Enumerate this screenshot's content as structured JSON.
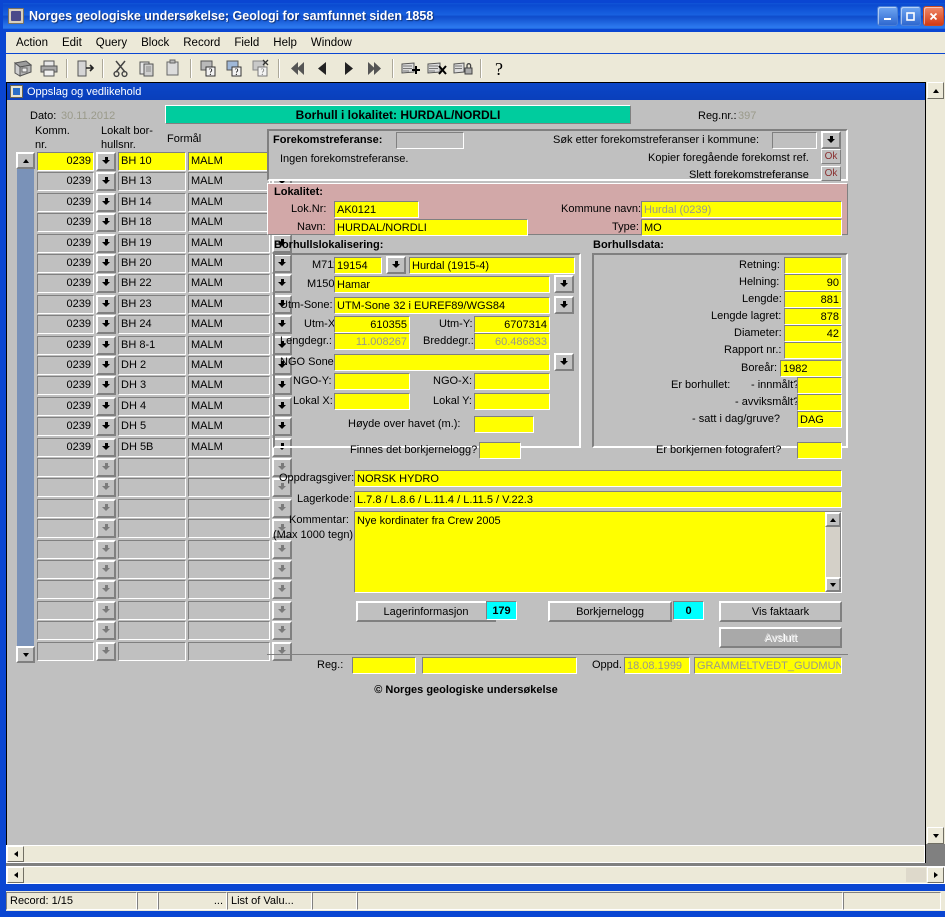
{
  "window": {
    "title": "Norges geologiske undersøkelse;  Geologi for samfunnet siden 1858",
    "minimize": "_",
    "maximize": "□",
    "close": "✕"
  },
  "menu": [
    {
      "label": "Action"
    },
    {
      "label": "Edit"
    },
    {
      "label": "Query"
    },
    {
      "label": "Block"
    },
    {
      "label": "Record"
    },
    {
      "label": "Field"
    },
    {
      "label": "Help"
    },
    {
      "label": "Window"
    }
  ],
  "toolbar": [
    {
      "name": "save-icon"
    },
    {
      "name": "print-icon"
    },
    {
      "sep": true
    },
    {
      "name": "exit-icon"
    },
    {
      "sep": true
    },
    {
      "name": "cut-icon"
    },
    {
      "name": "copy-icon"
    },
    {
      "name": "paste-icon"
    },
    {
      "sep": true
    },
    {
      "name": "enter-query-icon"
    },
    {
      "name": "execute-query-icon"
    },
    {
      "name": "cancel-query-icon"
    },
    {
      "sep": true
    },
    {
      "name": "first-record-icon"
    },
    {
      "name": "previous-record-icon"
    },
    {
      "name": "next-record-icon"
    },
    {
      "name": "last-record-icon"
    },
    {
      "sep": true
    },
    {
      "name": "insert-record-icon"
    },
    {
      "name": "delete-record-icon"
    },
    {
      "name": "lock-record-icon"
    },
    {
      "sep": true
    },
    {
      "name": "help-icon"
    }
  ],
  "mdi": {
    "title": "Oppslag og vedlikehold"
  },
  "header": {
    "date_label": "Dato:",
    "date_value": "30.11.2012",
    "banner": "Borhull i lokalitet: HURDAL/NORDLI",
    "regnr_label": "Reg.nr.:",
    "regnr_value": "397"
  },
  "grid": {
    "columns": [
      "Komm.\nnr.",
      "Lokalt bor-\nhullsnr.",
      "Formål"
    ],
    "col1_header_l1": "Komm.",
    "col1_header_l2": "nr.",
    "col2_header_l1": "Lokalt bor-",
    "col2_header_l2": "hullsnr.",
    "col3_header": "Formål",
    "rows": [
      {
        "komm": "0239",
        "borhull": "BH 10",
        "formal": "MALM",
        "current": true
      },
      {
        "komm": "0239",
        "borhull": "BH 13",
        "formal": "MALM",
        "current": false
      },
      {
        "komm": "0239",
        "borhull": "BH 14",
        "formal": "MALM",
        "current": false
      },
      {
        "komm": "0239",
        "borhull": "BH 18",
        "formal": "MALM",
        "current": false
      },
      {
        "komm": "0239",
        "borhull": "BH 19",
        "formal": "MALM",
        "current": false
      },
      {
        "komm": "0239",
        "borhull": "BH 20",
        "formal": "MALM",
        "current": false
      },
      {
        "komm": "0239",
        "borhull": "BH 22",
        "formal": "MALM",
        "current": false
      },
      {
        "komm": "0239",
        "borhull": "BH 23",
        "formal": "MALM",
        "current": false
      },
      {
        "komm": "0239",
        "borhull": "BH 24",
        "formal": "MALM",
        "current": false
      },
      {
        "komm": "0239",
        "borhull": "BH 8-1",
        "formal": "MALM",
        "current": false
      },
      {
        "komm": "0239",
        "borhull": "DH 2",
        "formal": "MALM",
        "current": false
      },
      {
        "komm": "0239",
        "borhull": "DH 3",
        "formal": "MALM",
        "current": false
      },
      {
        "komm": "0239",
        "borhull": "DH 4",
        "formal": "MALM",
        "current": false
      },
      {
        "komm": "0239",
        "borhull": "DH 5",
        "formal": "MALM",
        "current": false
      },
      {
        "komm": "0239",
        "borhull": "DH 5B",
        "formal": "MALM",
        "current": false
      },
      {
        "komm": "",
        "borhull": "",
        "formal": "",
        "current": false
      },
      {
        "komm": "",
        "borhull": "",
        "formal": "",
        "current": false
      },
      {
        "komm": "",
        "borhull": "",
        "formal": "",
        "current": false
      },
      {
        "komm": "",
        "borhull": "",
        "formal": "",
        "current": false
      },
      {
        "komm": "",
        "borhull": "",
        "formal": "",
        "current": false
      },
      {
        "komm": "",
        "borhull": "",
        "formal": "",
        "current": false
      },
      {
        "komm": "",
        "borhull": "",
        "formal": "",
        "current": false
      },
      {
        "komm": "",
        "borhull": "",
        "formal": "",
        "current": false
      },
      {
        "komm": "",
        "borhull": "",
        "formal": "",
        "current": false
      },
      {
        "komm": "",
        "borhull": "",
        "formal": "",
        "current": false
      },
      {
        "komm": "",
        "borhull": "",
        "formal": "",
        "current": false
      },
      {
        "komm": "",
        "borhull": "",
        "formal": "",
        "current": false
      },
      {
        "komm": "",
        "borhull": "",
        "formal": "",
        "current": false
      }
    ]
  },
  "forekomst": {
    "label": "Forekomstreferanse:",
    "value": "",
    "none_text": "Ingen forekomstreferanse.",
    "search_label": "Søk etter forekomstreferanser i kommune:",
    "search_value": "",
    "copy_label": "Kopier foregående forekomst ref.",
    "copy_ok": "Ok",
    "delete_label": "Slett forekomstreferanse",
    "delete_ok": "Ok"
  },
  "lokalitet": {
    "title": "Lokalitet:",
    "loknr_label": "Lok.Nr:",
    "loknr_value": "AK0121",
    "navn_label": "Navn:",
    "navn_value": "HURDAL/NORDLI",
    "kommune_label": "Kommune navn:",
    "kommune_value": "Hurdal (0239)",
    "type_label": "Type:",
    "type_value": "MO"
  },
  "lokalisering": {
    "title": "Borhullslokalisering:",
    "m711_label": "M711:",
    "m711_value": "19154",
    "m711_name": "Hurdal (1915-4)",
    "m1501_label": "M1501:",
    "m1501_value": "Hamar",
    "utmsone_label": "Utm-Sone:",
    "utmsone_value": "UTM-Sone 32 i  EUREF89/WGS84",
    "utmx_label": "Utm-X:",
    "utmx_value": "610355",
    "utmy_label": "Utm-Y:",
    "utmy_value": "6707314",
    "lengdegr_label": "Lengdegr.:",
    "lengdegr_value": "11.008267",
    "breddegr_label": "Breddegr.:",
    "breddegr_value": "60.486833",
    "ngosone_label": "NGO Sone:",
    "ngosone_value": "",
    "ngoy_label": "NGO-Y:",
    "ngoy_value": "",
    "ngox_label": "NGO-X:",
    "ngox_value": "",
    "lokalx_label": "Lokal X:",
    "lokalx_value": "",
    "lokaly_label": "Lokal Y:",
    "lokaly_value": "",
    "hoyde_label": "Høyde over havet (m.):",
    "hoyde_value": ""
  },
  "borhullsdata": {
    "title": "Borhullsdata:",
    "retning_label": "Retning:",
    "retning_value": "",
    "helning_label": "Helning:",
    "helning_value": "90",
    "lengde_label": "Lengde:",
    "lengde_value": "881",
    "lengdelagret_label": "Lengde lagret:",
    "lengdelagret_value": "878",
    "diameter_label": "Diameter:",
    "diameter_value": "42",
    "rapport_label": "Rapport nr.:",
    "rapport_value": "",
    "borear_label": "Boreår:",
    "borear_value": "1982",
    "erborhullet_label": "Er borhullet:",
    "innmalt_label": "- innmålt?",
    "innmalt_value": "",
    "avviksmalt_label": "- avviksmålt?",
    "avviksmalt_value": "",
    "dag_label": "- satt i dag/gruve?",
    "dag_value": "DAG"
  },
  "bottom": {
    "borkjernelogg_label": "Finnes det borkjernelogg?",
    "borkjernelogg_value": "",
    "fotografert_label": "Er borkjernen fotografert?",
    "fotografert_value": "",
    "oppdragsgiver_label": "Oppdragsgiver:",
    "oppdragsgiver_value": "NORSK HYDRO",
    "lagerkode_label": "Lagerkode:",
    "lagerkode_value": "L.7.8 /  L.8.6 / L.11.4 / L.11.5 / V.22.3",
    "kommentar_label": "Kommentar:",
    "kommentar_sub": "(Max 1000 tegn)",
    "kommentar_value": "Nye kordinater fra Crew 2005"
  },
  "buttons": {
    "lagerinformasjon": "Lagerinformasjon",
    "lagerinformasjon_count": "179",
    "borkjernelogg": "Borkjernelogg",
    "borkjernelogg_count": "0",
    "vis_faktaark": "Vis faktaark",
    "avslutt": "Avslutt"
  },
  "footer": {
    "reg_label": "Reg.:",
    "reg_value1": "",
    "reg_value2": "",
    "oppd_label": "Oppd.",
    "oppd_date": "18.08.1999",
    "oppd_user": "GRAMMELTVEDT_GUDMUND",
    "copyright": "© Norges geologiske undersøkelse"
  },
  "status": {
    "record": "Record: 1/15",
    "cell2": "",
    "cell3": "...",
    "cell4": "List of Valu...",
    "cell5": "",
    "cell6": "",
    "cell7": ""
  },
  "colors": {
    "title_blue": "#0a46d2",
    "field_yellow": "#ffff00",
    "banner_teal": "#00cc9e",
    "lokalitet_pink": "#d2a8a8",
    "count_cyan": "#00ffff",
    "face": "#c0c0c0"
  }
}
